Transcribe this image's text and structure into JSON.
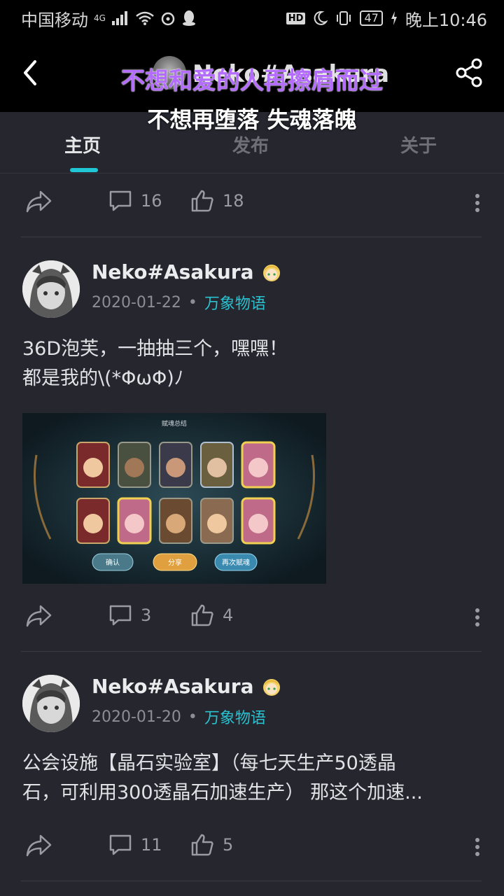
{
  "status_bar": {
    "carrier": "中国移动",
    "signal": "4G",
    "battery": "47",
    "time": "晚上10:46"
  },
  "header": {
    "username": "Neko#Asakura",
    "lyric_top": "不想和爱的人再擦肩而过",
    "lyric_bottom": "不想再堕落 失魂落魄"
  },
  "tabs": [
    {
      "label": "主页",
      "active": true
    },
    {
      "label": "发布",
      "active": false
    },
    {
      "label": "关于",
      "active": false
    }
  ],
  "posts": [
    {
      "comments": "16",
      "likes": "18"
    },
    {
      "author": "Neko#Asakura",
      "date": "2020-01-22",
      "topic": "万象物语",
      "text_line1": "36D泡芙，一抽抽三个，嘿嘿！",
      "text_line2": "都是我的\\(*ΦωΦ)ﾉ",
      "image_title": "赋魂总结",
      "image_buttons": [
        "确认",
        "分享",
        "再次赋魂"
      ],
      "comments": "3",
      "likes": "4"
    },
    {
      "author": "Neko#Asakura",
      "date": "2020-01-20",
      "topic": "万象物语",
      "text_line1": "公会设施【晶石实验室】（每七天生产50透晶",
      "text_line2": "石，可利用300透晶石加速生产） 那这个加速...",
      "comments": "11",
      "likes": "5"
    }
  ],
  "colors": {
    "background": "#25262e",
    "accent": "#1fc7d4",
    "topic": "#28c2d0"
  }
}
